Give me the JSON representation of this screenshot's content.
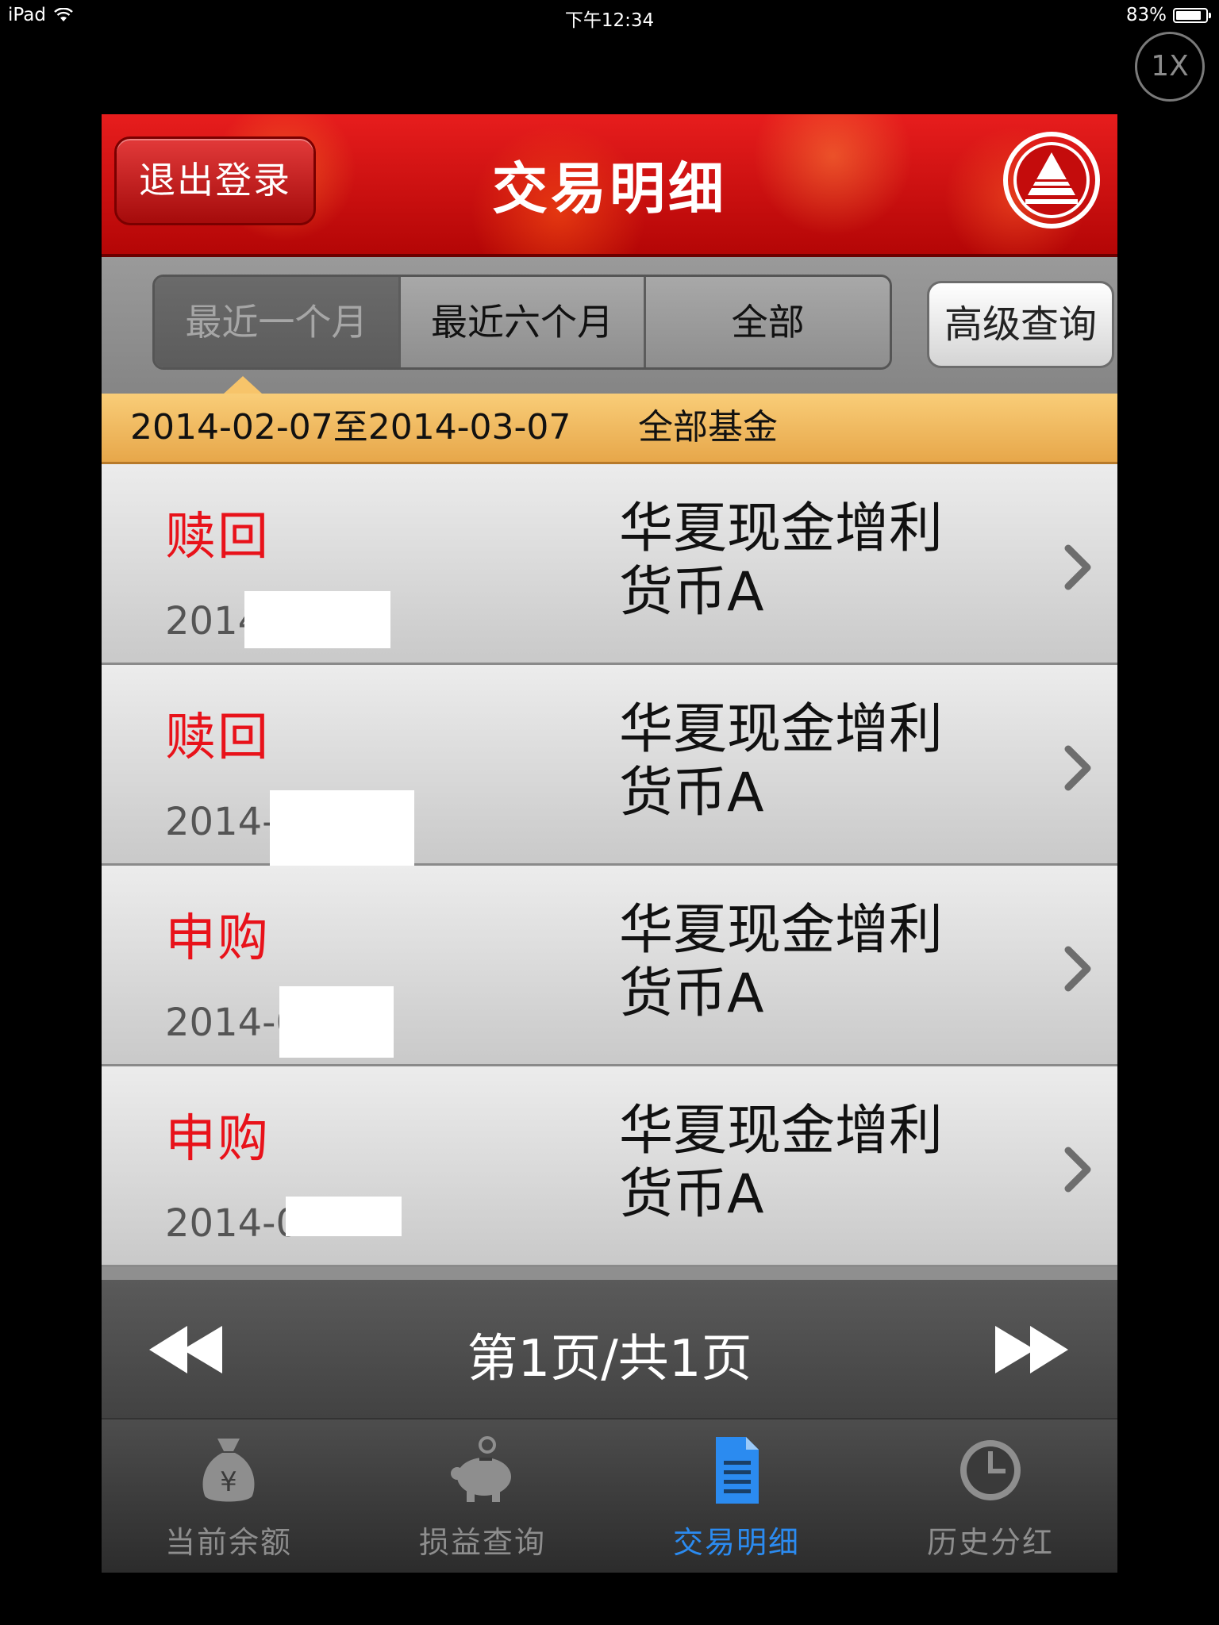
{
  "status_bar": {
    "device": "iPad",
    "time": "下午12:34",
    "battery": "83%"
  },
  "zoom_button": "1X",
  "header": {
    "logout_label": "退出登录",
    "title": "交易明细"
  },
  "filter": {
    "segments": [
      "最近一个月",
      "最近六个月",
      "全部"
    ],
    "selected_segment": "最近一个月",
    "advanced_label": "高级查询"
  },
  "range_bar": {
    "date_range": "2014-02-07至2014-03-07",
    "fund_filter": "全部基金"
  },
  "transactions": [
    {
      "type": "赎回",
      "date_visible": "2014",
      "fund_line1": "华夏现金增利",
      "fund_line2": "货币A"
    },
    {
      "type": "赎回",
      "date_visible": "2014-",
      "fund_line1": "华夏现金增利",
      "fund_line2": "货币A"
    },
    {
      "type": "申购",
      "date_visible": "2014-0",
      "fund_line1": "华夏现金增利",
      "fund_line2": "货币A"
    },
    {
      "type": "申购",
      "date_visible": "2014-0",
      "fund_line1": "华夏现金增利",
      "fund_line2": "货币A"
    }
  ],
  "pager": {
    "text": "第1页/共1页"
  },
  "tabs": [
    {
      "label": "当前余额",
      "icon": "money-bag-icon"
    },
    {
      "label": "损益查询",
      "icon": "piggy-bank-icon"
    },
    {
      "label": "交易明细",
      "icon": "document-icon",
      "active": true
    },
    {
      "label": "历史分红",
      "icon": "clock-icon"
    }
  ],
  "colors": {
    "accent": "#2b8bf0",
    "transaction_type": "#e8121a",
    "header": "#d51212"
  }
}
